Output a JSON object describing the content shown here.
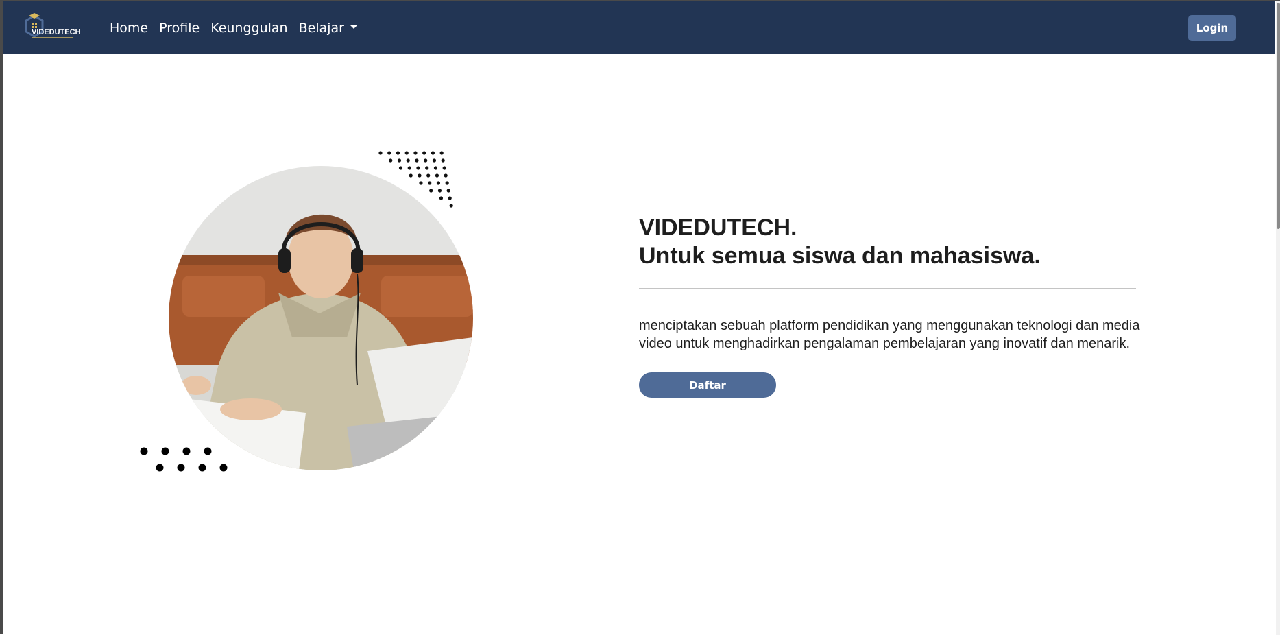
{
  "brand": {
    "name": "VIDEDUTECH",
    "logo_icon": "graduation-cap-hexagon-logo"
  },
  "nav": {
    "items": [
      {
        "label": "Home"
      },
      {
        "label": "Profile"
      },
      {
        "label": "Keunggulan"
      },
      {
        "label": "Belajar",
        "has_dropdown": true
      }
    ],
    "login_label": "Login"
  },
  "hero": {
    "title_line1": "VIDEDUTECH.",
    "title_line2": "Untuk semua siswa dan mahasiswa.",
    "description": "menciptakan sebuah platform pendidikan yang menggunakan teknologi dan media video untuk menghadirkan pengalaman pembelajaran yang inovatif dan menarik.",
    "cta_label": "Daftar",
    "image_icon": "student-with-headphones-photo"
  },
  "colors": {
    "navbar_bg": "#223554",
    "button_bg": "#4f6b97",
    "text": "#1e1e1e",
    "logo_accent": "#d9b95c"
  }
}
